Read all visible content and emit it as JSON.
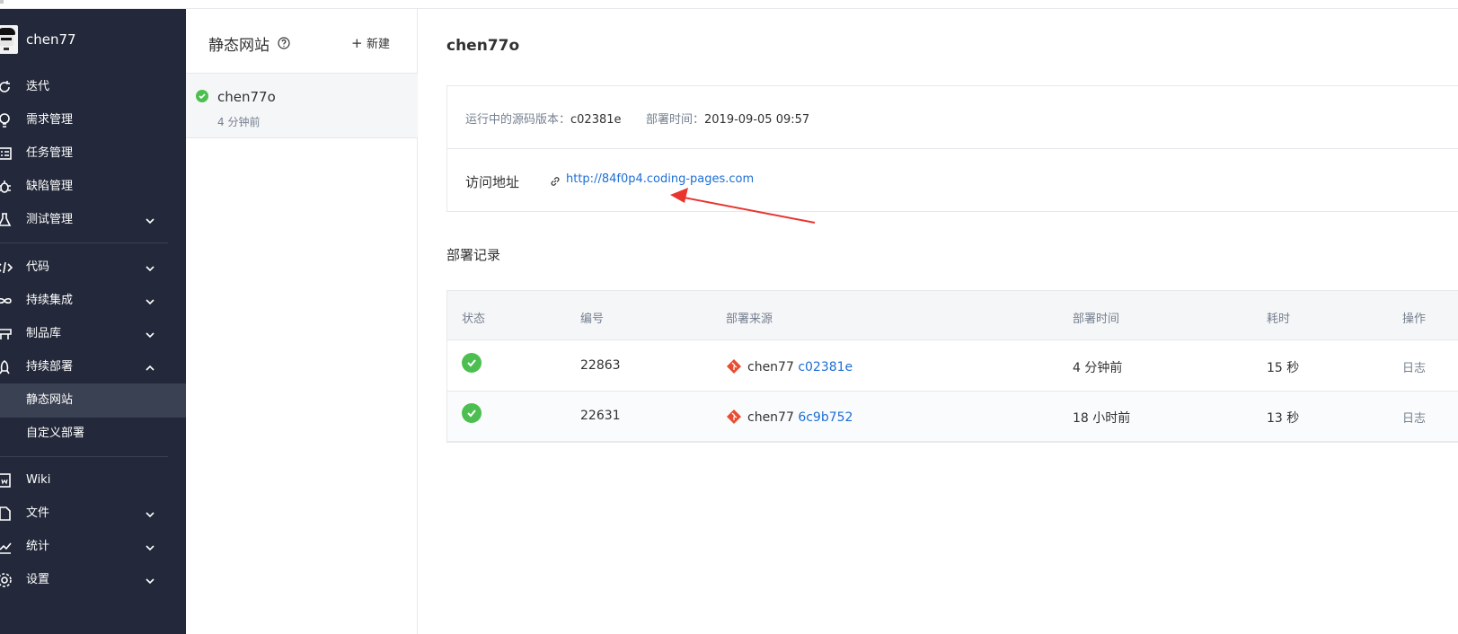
{
  "sidebar": {
    "project_name": "chen77",
    "items": [
      {
        "label": "迭代",
        "icon": "iteration-icon",
        "chevron": false
      },
      {
        "label": "需求管理",
        "icon": "bulb-icon",
        "chevron": false
      },
      {
        "label": "任务管理",
        "icon": "task-list-icon",
        "chevron": false
      },
      {
        "label": "缺陷管理",
        "icon": "bug-icon",
        "chevron": false
      },
      {
        "label": "测试管理",
        "icon": "flask-icon",
        "chevron": "down"
      },
      {
        "label": "代码",
        "icon": "code-icon",
        "chevron": "down"
      },
      {
        "label": "持续集成",
        "icon": "infinity-icon",
        "chevron": "down"
      },
      {
        "label": "制品库",
        "icon": "package-icon",
        "chevron": "down"
      },
      {
        "label": "持续部署",
        "icon": "rocket-icon",
        "chevron": "up"
      },
      {
        "label": "静态网站",
        "sub": true,
        "active": true
      },
      {
        "label": "自定义部署",
        "sub": true
      },
      {
        "label": "Wiki",
        "icon": "wiki-icon",
        "chevron": false
      },
      {
        "label": "文件",
        "icon": "file-icon",
        "chevron": "down"
      },
      {
        "label": "统计",
        "icon": "chart-icon",
        "chevron": "down"
      },
      {
        "label": "设置",
        "icon": "gear-icon",
        "chevron": "down"
      }
    ]
  },
  "sites_panel": {
    "title": "静态网站",
    "new_label": "新建",
    "items": [
      {
        "name": "chen77o",
        "time": "4 分钟前",
        "status": "success"
      }
    ]
  },
  "main": {
    "title": "chen77o",
    "source_version_label": "运行中的源码版本：",
    "source_version": "c02381e",
    "deploy_time_label": "部署时间：",
    "deploy_time": "2019-09-05 09:57",
    "access_label": "访问地址",
    "access_url": "http://84f0p4.coding-pages.com",
    "records_title": "部署记录",
    "table": {
      "headers": [
        "状态",
        "编号",
        "部署来源",
        "部署时间",
        "耗时",
        "操作"
      ],
      "rows": [
        {
          "status": "success",
          "id": "22863",
          "source_user": "chen77",
          "source_commit": "c02381e",
          "time": "4 分钟前",
          "duration": "15 秒",
          "op": "日志"
        },
        {
          "status": "success",
          "id": "22631",
          "source_user": "chen77",
          "source_commit": "6c9b752",
          "time": "18 小时前",
          "duration": "13 秒",
          "op": "日志"
        }
      ]
    }
  },
  "colors": {
    "sidebar_bg": "#23293a",
    "sidebar_active": "#3a4152",
    "link": "#1d6ed6",
    "success": "#4cbf50",
    "git_brand": "#e84d31",
    "annotation_arrow": "#e8352e"
  }
}
